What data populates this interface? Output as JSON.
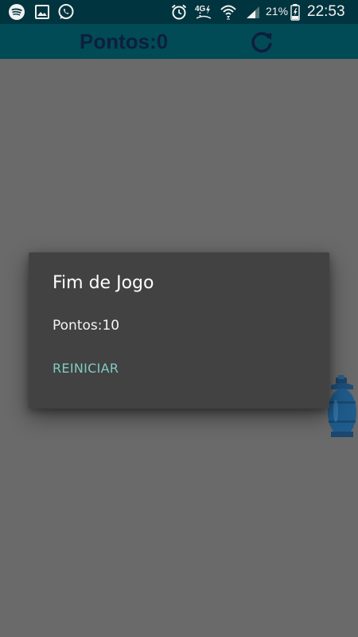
{
  "status_bar": {
    "battery_percent": "21%",
    "clock": "22:53",
    "network_type": "4G",
    "icons": [
      "spotify-icon",
      "gallery-icon",
      "whatsapp-icon",
      "alarm-icon",
      "4g-data-icon",
      "wifi-icon",
      "signal-icon",
      "battery-charging-icon"
    ]
  },
  "app_bar": {
    "score_label": "Pontos:0",
    "refresh_icon": "refresh-icon"
  },
  "game": {
    "sprite_icon": "gas-cylinder-icon"
  },
  "dialog": {
    "title": "Fim de Jogo",
    "message": "Pontos:10",
    "button_label": "REINICIAR"
  },
  "colors": {
    "status_bar_bg": "#00343e",
    "app_bar_bg": "#004b56",
    "score_text": "#0e1e3e",
    "background_dim": "#6a6a6a",
    "dialog_bg": "#424242",
    "accent": "#80cbc4"
  }
}
